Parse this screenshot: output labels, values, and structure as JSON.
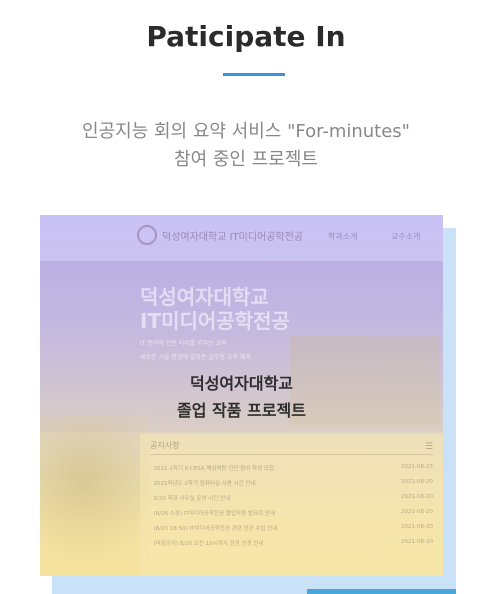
{
  "section": {
    "title": "Paticipate In",
    "subtitle_line1": "인공지능 회의 요약 서비스 \"For-minutes\"",
    "subtitle_line2": "참여 중인 프로젝트"
  },
  "card": {
    "overlay_line1": "덕성여자대학교",
    "overlay_line2": "졸업 작품 프로젝트",
    "site": {
      "logo_text": "덕성여자대학교 IT미디어공학전공",
      "nav": [
        "학과소개",
        "교수소개"
      ],
      "hero_title_line1": "덕성여자대학교",
      "hero_title_line2": "IT미디어공학전공",
      "hero_line1": "IT 분야의 전문 리더를 키우는 교육",
      "hero_line2": "새로운 기술 환경에 발맞춘 실무형 교육 체계",
      "notice_title": "공지사항",
      "notices": [
        {
          "title": "· 2021-2학기 K-CESA 핵심역량 진단 참여 학생 모집",
          "date": "2021-08-27"
        },
        {
          "title": "· 2021학년도 2학기 컴퓨터실 사용 시간 안내",
          "date": "2021-08-20"
        },
        {
          "title": "· 8/20 학과 사무실 운영 시간 안내",
          "date": "2021-08-20"
        },
        {
          "title": "· (8/26 수정) IT미디어공학전공 졸업작품 발표회 안내",
          "date": "2021-08-20"
        },
        {
          "title": "· (8/20 18:50) IT미디어공학전공 관련 전공 수업 안내",
          "date": "2021-08-20"
        },
        {
          "title": "· (마감공지) 8/20 오전 10시까지 전공 신청 안내",
          "date": "2021-08-20"
        }
      ]
    }
  },
  "colors": {
    "accent": "#3d8fe0",
    "shadow_block": "#c9e2f7",
    "shadow_accent": "#4aa7dc"
  }
}
